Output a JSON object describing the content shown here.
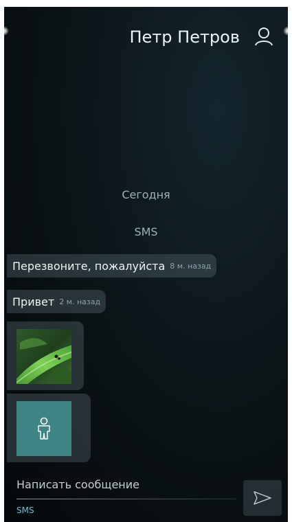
{
  "header": {
    "contact_name": "Петр Петров",
    "contact_icon": "person-icon"
  },
  "conversation": {
    "date_label": "Сегодня",
    "channel_label": "SMS",
    "messages": [
      {
        "text": "Перезвоните, пожалуйста",
        "time": "8 м. назад"
      },
      {
        "text": "Привет",
        "time": "2 м. назад"
      }
    ],
    "attachments": [
      {
        "type": "image",
        "icon": "photo-thumbnail"
      },
      {
        "type": "vcard",
        "icon": "person-contact-icon"
      }
    ]
  },
  "composer": {
    "placeholder": "Написать сообщение",
    "channel": "SMS",
    "send_icon": "send-icon"
  },
  "colors": {
    "accent": "#6fc3d2",
    "vcard_tile": "#3f8585",
    "background": "#0c1519"
  }
}
